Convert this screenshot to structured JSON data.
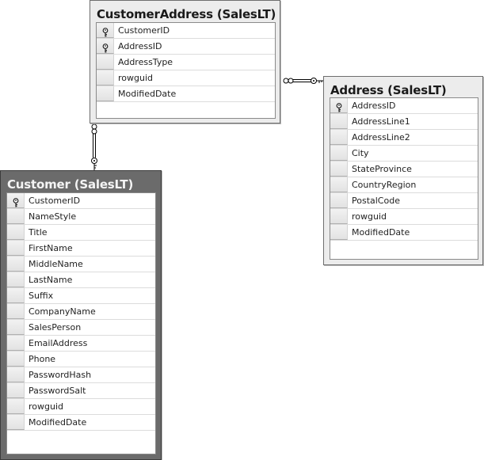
{
  "diagram": {
    "tables": [
      {
        "id": "customer-address",
        "title": "CustomerAddress (SalesLT)",
        "selected": false,
        "columns": [
          {
            "name": "CustomerID",
            "primary_key": true
          },
          {
            "name": "AddressID",
            "primary_key": true
          },
          {
            "name": "AddressType",
            "primary_key": false
          },
          {
            "name": "rowguid",
            "primary_key": false
          },
          {
            "name": "ModifiedDate",
            "primary_key": false
          }
        ]
      },
      {
        "id": "address",
        "title": "Address (SalesLT)",
        "selected": false,
        "columns": [
          {
            "name": "AddressID",
            "primary_key": true
          },
          {
            "name": "AddressLine1",
            "primary_key": false
          },
          {
            "name": "AddressLine2",
            "primary_key": false
          },
          {
            "name": "City",
            "primary_key": false
          },
          {
            "name": "StateProvince",
            "primary_key": false
          },
          {
            "name": "CountryRegion",
            "primary_key": false
          },
          {
            "name": "PostalCode",
            "primary_key": false
          },
          {
            "name": "rowguid",
            "primary_key": false
          },
          {
            "name": "ModifiedDate",
            "primary_key": false
          }
        ]
      },
      {
        "id": "customer",
        "title": "Customer (SalesLT)",
        "selected": true,
        "columns": [
          {
            "name": "CustomerID",
            "primary_key": true
          },
          {
            "name": "NameStyle",
            "primary_key": false
          },
          {
            "name": "Title",
            "primary_key": false
          },
          {
            "name": "FirstName",
            "primary_key": false
          },
          {
            "name": "MiddleName",
            "primary_key": false
          },
          {
            "name": "LastName",
            "primary_key": false
          },
          {
            "name": "Suffix",
            "primary_key": false
          },
          {
            "name": "CompanyName",
            "primary_key": false
          },
          {
            "name": "SalesPerson",
            "primary_key": false
          },
          {
            "name": "EmailAddress",
            "primary_key": false
          },
          {
            "name": "Phone",
            "primary_key": false
          },
          {
            "name": "PasswordHash",
            "primary_key": false
          },
          {
            "name": "PasswordSalt",
            "primary_key": false
          },
          {
            "name": "rowguid",
            "primary_key": false
          },
          {
            "name": "ModifiedDate",
            "primary_key": false
          }
        ]
      }
    ],
    "relationships": [
      {
        "from": "customer-address",
        "to": "address",
        "type": "many-to-one"
      },
      {
        "from": "customer-address",
        "to": "customer",
        "type": "many-to-one"
      }
    ]
  }
}
